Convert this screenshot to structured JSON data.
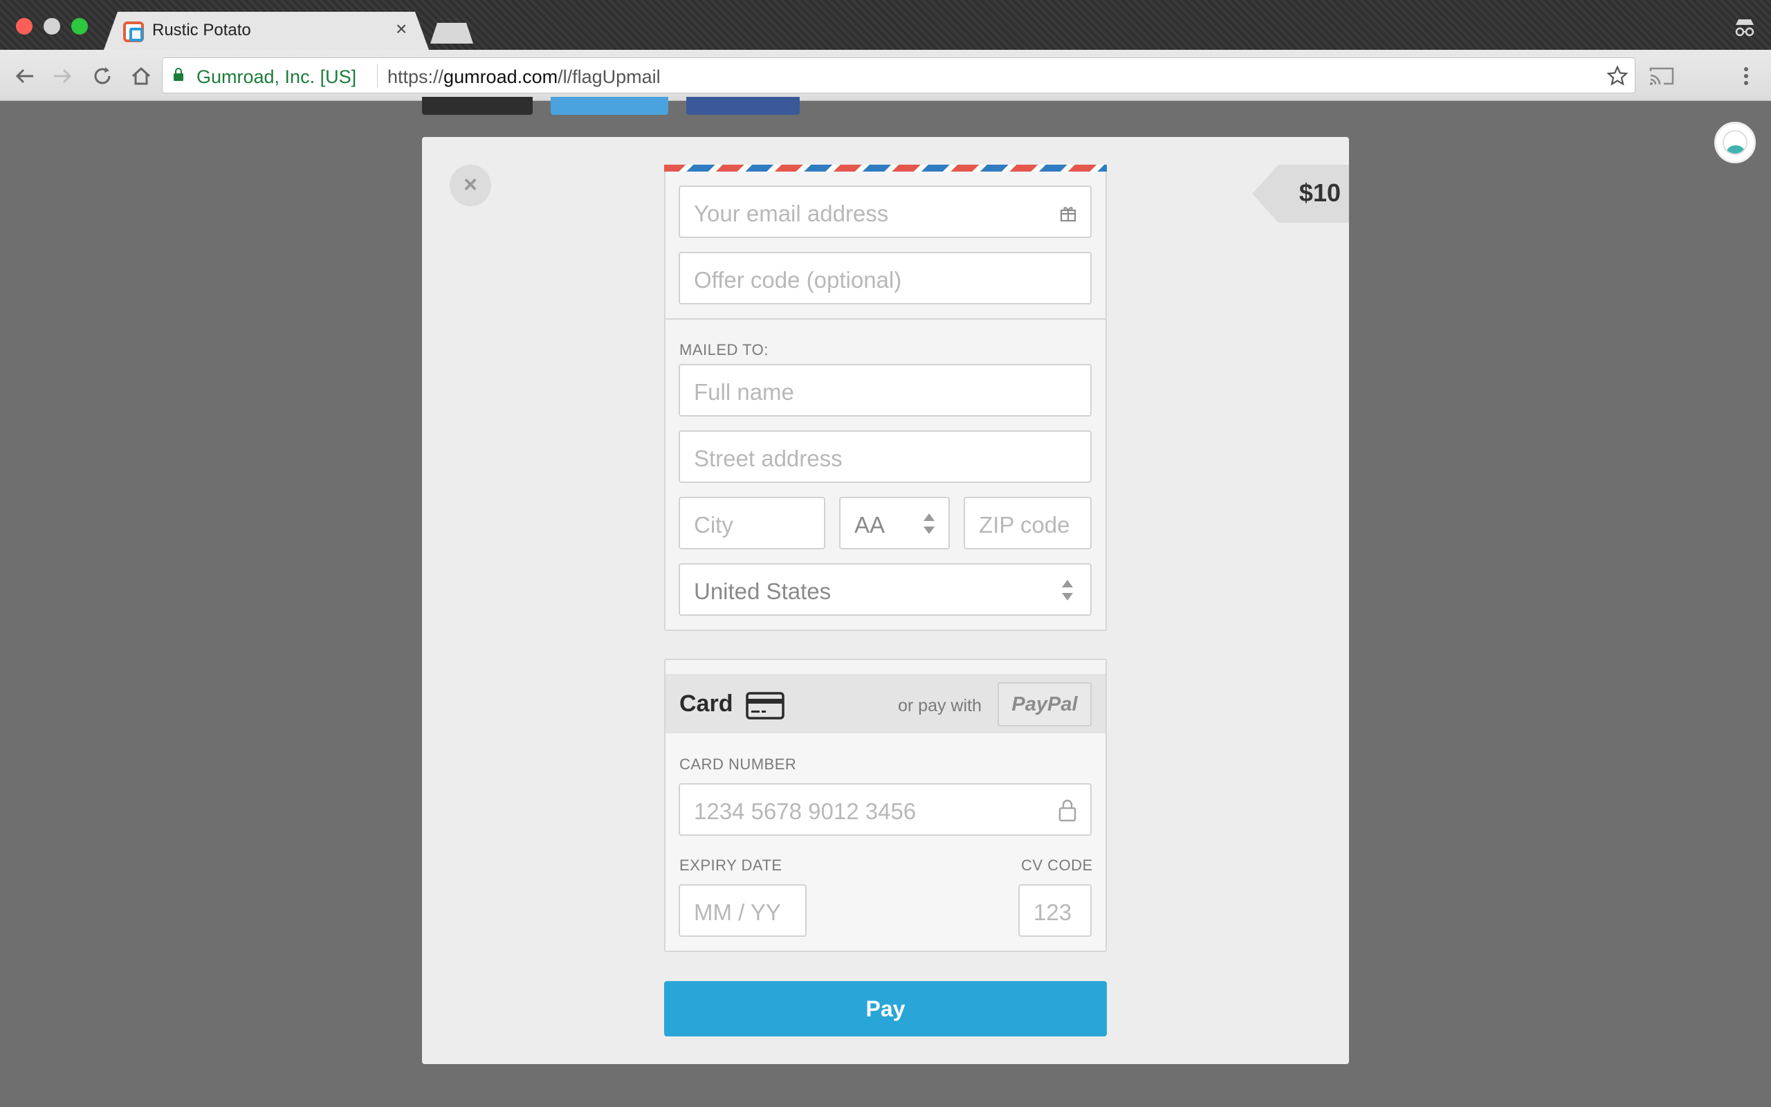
{
  "browser": {
    "tab_title": "Rustic Potato",
    "tab_close": "×",
    "site_identity": "Gumroad, Inc. [US]",
    "url_scheme": "https://",
    "url_host": "gumroad.com",
    "url_path": "/l/flagUpmail"
  },
  "modal": {
    "close_label": "×",
    "price": "$10",
    "email_placeholder": "Your email address",
    "offer_placeholder": "Offer code (optional)",
    "mailed_to_label": "MAILED TO:",
    "fullname_placeholder": "Full name",
    "street_placeholder": "Street address",
    "city_placeholder": "City",
    "state_value": "AA",
    "zip_placeholder": "ZIP code",
    "country_value": "United States"
  },
  "payment": {
    "card_label": "Card",
    "or_pay_with": "or pay with",
    "paypal_label": "PayPal",
    "card_number_label": "CARD NUMBER",
    "card_number_placeholder": "1234 5678 9012 3456",
    "expiry_label": "EXPIRY DATE",
    "expiry_placeholder": "MM / YY",
    "cvc_label": "CV CODE",
    "cvc_placeholder": "123",
    "pay_button": "Pay"
  },
  "colors": {
    "pay_button": "#2aa5d8",
    "site_identity": "#1c7d3a",
    "airmail_red": "#e5574b",
    "airmail_blue": "#2f7cc2"
  }
}
